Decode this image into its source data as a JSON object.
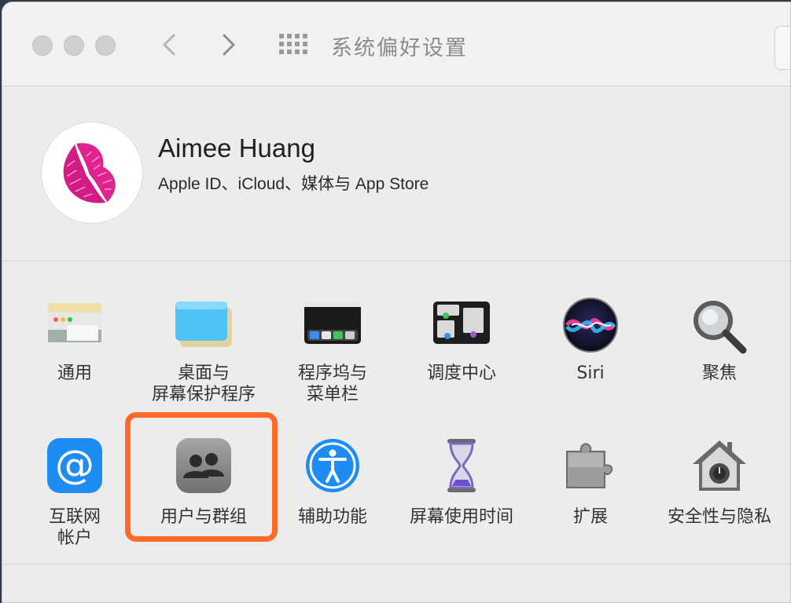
{
  "window": {
    "title": "系统偏好设置",
    "back_icon": "chevron-left-icon",
    "forward_icon": "chevron-right-icon",
    "show_all_icon": "grid-icon"
  },
  "profile": {
    "name": "Aimee Huang",
    "subtitle": "Apple ID、iCloud、媒体与 App Store",
    "avatar_icon": "lips-avatar"
  },
  "row1": [
    {
      "label_lines": [
        "通用"
      ],
      "icon": "general-icon"
    },
    {
      "label_lines": [
        "桌面与",
        "屏幕保护程序"
      ],
      "icon": "desktop-screensaver-icon"
    },
    {
      "label_lines": [
        "程序坞与",
        "菜单栏"
      ],
      "icon": "dock-menubar-icon"
    },
    {
      "label_lines": [
        "调度中心"
      ],
      "icon": "mission-control-icon"
    },
    {
      "label_lines": [
        "Siri"
      ],
      "icon": "siri-icon"
    },
    {
      "label_lines": [
        "聚焦"
      ],
      "icon": "spotlight-icon"
    }
  ],
  "row2": [
    {
      "label_lines": [
        "互联网",
        "帐户"
      ],
      "icon": "internet-accounts-icon"
    },
    {
      "label_lines": [
        "用户与群组"
      ],
      "icon": "users-groups-icon"
    },
    {
      "label_lines": [
        "辅助功能"
      ],
      "icon": "accessibility-icon"
    },
    {
      "label_lines": [
        "屏幕使用时间"
      ],
      "icon": "screen-time-icon"
    },
    {
      "label_lines": [
        "扩展"
      ],
      "icon": "extensions-icon"
    },
    {
      "label_lines": [
        "安全性与隐私"
      ],
      "icon": "security-privacy-icon"
    }
  ],
  "highlight_color": "#ff6a2b"
}
